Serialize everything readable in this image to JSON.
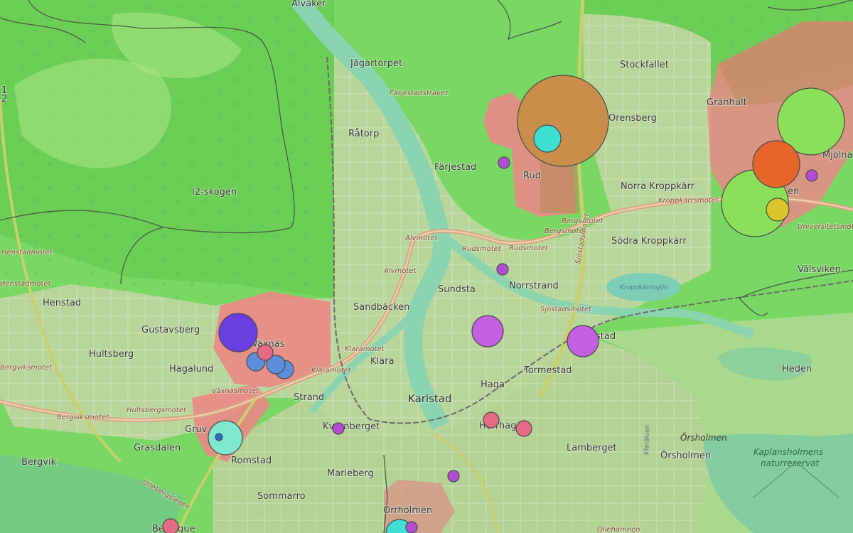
{
  "colors": {
    "forest": "#5fd05a",
    "light_green": "#a6ea7a",
    "urban": "#b9d49a",
    "red_zone": "#e98a86",
    "river": "#8fd6b7",
    "road_orange": "#d6a07a",
    "marker_purple": "#b24cd6",
    "marker_violet": "#6a3fe0",
    "marker_pink": "#e56a86",
    "marker_blue": "#5b8fd9",
    "marker_cyan": "#3fe0d4",
    "marker_brown": "#c98f4a",
    "marker_orange": "#e6662a",
    "marker_lime": "#8be05a",
    "marker_yellow": "#d9c52a"
  },
  "labels": {
    "alvaker": "Alväker",
    "jagartorpet": "Jägartorpet",
    "stockfallet": "Stockfallet",
    "granhult": "Granhult",
    "mjolnar": "Mjölna",
    "orensberg": "Orensberg",
    "ratorp": "Råtorp",
    "farjestad": "Färjestad",
    "rud": "Rud",
    "norra_kroppkarr": "Norra Kroppkärr",
    "i2_skogen": "I2-skogen",
    "sodra_kroppkarr": "Södra Kroppkärr",
    "valsviken": "Välsviken",
    "sundsta": "Sundsta",
    "norrstrand": "Norrstrand",
    "henstad": "Henstad",
    "sandbacken": "Sandbäcken",
    "gustavsberg": "Gustavsberg",
    "vaxnas": "Växnäs",
    "hultsberg": "Hultsberg",
    "hagalund": "Hagalund",
    "klara": "Klara",
    "tormestad": "Tormestad",
    "heden": "Heden",
    "haga": "Haga",
    "strand": "Strand",
    "karlstad": "Karlstad",
    "gruvl": "Gruv",
    "kvarnberget": "Kvarnberget",
    "herrhagen": "Herrhagen",
    "grasdalen": "Grasdalen",
    "lamberget": "Lamberget",
    "orsholmen": "Örsholmen",
    "orsholmen_ital": "Örsholmen",
    "bergvik": "Bergvik",
    "romstad": "Romstad",
    "marieberg": "Marieberg",
    "sommarro": "Sommarro",
    "orrholmen": "Orrholmen",
    "tingvalla_partial": "stad",
    "heden_partial": "en",
    "bergvik_partial": "Be",
    "bergvik_partial2": "gue"
  },
  "road_labels": {
    "farjestadstravet": "Färjestadstravet",
    "henstadmotet": "Henstadmotet",
    "henstadmotet2": "Henstadmotet",
    "alvmotet": "Älvmotet",
    "alvmotet2": "Älvmotet",
    "rudsmotet": "Rudsmotet",
    "rudsmotet2": "Rudsmotet",
    "bergsmotet": "Bergsmotet",
    "bergsmotet2": "Bergsmotet",
    "kroppkarrsmotet": "Kroppkärrsmotet",
    "universitetsmotet": "Universitetsmot",
    "sjostadsmotet": "Sjöstadsmotet",
    "sjostadsmotet2": "Sjöstadsmotet",
    "klaramotet": "Klaramotet",
    "klaramotet2": "Klaramotet",
    "vaxnasmotet": "Växnäsmotet",
    "bergviksmotet": "Bergviksmotet",
    "bergviksmotet2": "Bergviksmotet",
    "hultsbergsmotet": "Hultsbergsmotet",
    "ullebergsleden": "Ullebergsleden",
    "olebamnen": "Oliehamnen"
  },
  "water_labels": {
    "kroppkarrssjon": "Kroppkärrssjön",
    "klaralven": "Klarälven"
  },
  "nature_reserve": {
    "line1": "Kaplansholmens",
    "line2": "naturreservat"
  },
  "edge_labels": {
    "e1": "1",
    "e2": "2"
  },
  "markers": [
    {
      "name": "farjestad",
      "color": "#b24cd6",
      "size": 1
    },
    {
      "name": "rud-large",
      "color": "#c98f4a",
      "size": 10
    },
    {
      "name": "rud-cyan",
      "color": "#3fe0d4",
      "size": 3
    },
    {
      "name": "rudsmotet",
      "color": "#b24cd6",
      "size": 1
    },
    {
      "name": "sundsta",
      "color": "#b24cd6",
      "size": 3
    },
    {
      "name": "tingvalla",
      "color": "#b24cd6",
      "size": 3
    },
    {
      "name": "gustavsberg",
      "color": "#6a3fe0",
      "size": 4
    },
    {
      "name": "vaxnas-pink",
      "color": "#e56a86",
      "size": 2
    },
    {
      "name": "vaxnas-blue-1",
      "color": "#5b8fd9",
      "size": 2
    },
    {
      "name": "vaxnas-blue-2",
      "color": "#5b8fd9",
      "size": 2
    },
    {
      "name": "vaxnas-blue-3",
      "color": "#5b8fd9",
      "size": 2
    },
    {
      "name": "gruvlyckan",
      "color": "#7ee8d0",
      "size": 4
    },
    {
      "name": "gruvlyckan-inner",
      "color": "#2a6ad6",
      "size": 1
    },
    {
      "name": "kvarnberget",
      "color": "#b24cd6",
      "size": 1
    },
    {
      "name": "herrhagen-1",
      "color": "#e56a86",
      "size": 2
    },
    {
      "name": "herrhagen-2",
      "color": "#e56a86",
      "size": 2
    },
    {
      "name": "marieberg",
      "color": "#b24cd6",
      "size": 1
    },
    {
      "name": "orrholmen-cyan",
      "color": "#3fe0d4",
      "size": 3
    },
    {
      "name": "orrholmen-purple",
      "color": "#b24cd6",
      "size": 1
    },
    {
      "name": "bergvik-pink",
      "color": "#e56a86",
      "size": 2
    },
    {
      "name": "granhult-lime",
      "color": "#8be05a",
      "size": 7
    },
    {
      "name": "hedenstad-orange",
      "color": "#e6662a",
      "size": 5
    },
    {
      "name": "hedenstad-lime",
      "color": "#8be05a",
      "size": 7
    },
    {
      "name": "hedenstad-yellow",
      "color": "#d9c52a",
      "size": 2
    },
    {
      "name": "mjolnar-purple",
      "color": "#b24cd6",
      "size": 1
    }
  ]
}
